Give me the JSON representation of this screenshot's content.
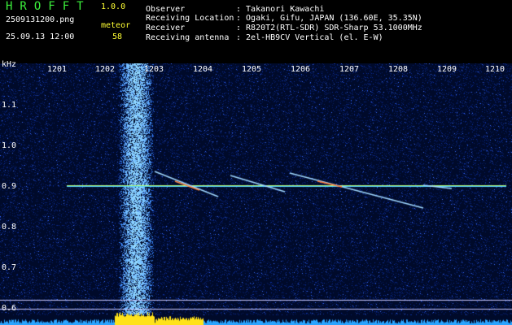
{
  "app": {
    "name": "HROFFT",
    "version": "1.0.0"
  },
  "file": {
    "name": "2509131200.png",
    "datetime": "25.09.13 12:00"
  },
  "detection": {
    "mode": "meteor",
    "count": "58"
  },
  "station": [
    {
      "label": "Observer",
      "value": ": Takanori Kawachi"
    },
    {
      "label": "Receiving Location",
      "value": ": Ogaki, Gifu, JAPAN (136.60E, 35.35N)"
    },
    {
      "label": "Receiver",
      "value": ": R820T2(RTL-SDR) SDR-Sharp 53.1000MHz"
    },
    {
      "label": "Receiving antenna",
      "value": ": 2el-HB9CV Vertical (el. E-W)"
    }
  ],
  "spectrogram": {
    "yunit": "kHz",
    "xticks": [
      "1201",
      "1202",
      "1203",
      "1204",
      "1205",
      "1206",
      "1207",
      "1208",
      "1209",
      "1210"
    ],
    "yticks": [
      "1.1",
      "1.0",
      "0.9",
      "0.8",
      "0.7",
      "0.6"
    ],
    "colors": {
      "background": "#000a2a",
      "noise": "#0a2a9a",
      "signal": "#7fd8ff",
      "carrier": "#b8ff7a",
      "bar": "#ffe21a"
    }
  }
}
